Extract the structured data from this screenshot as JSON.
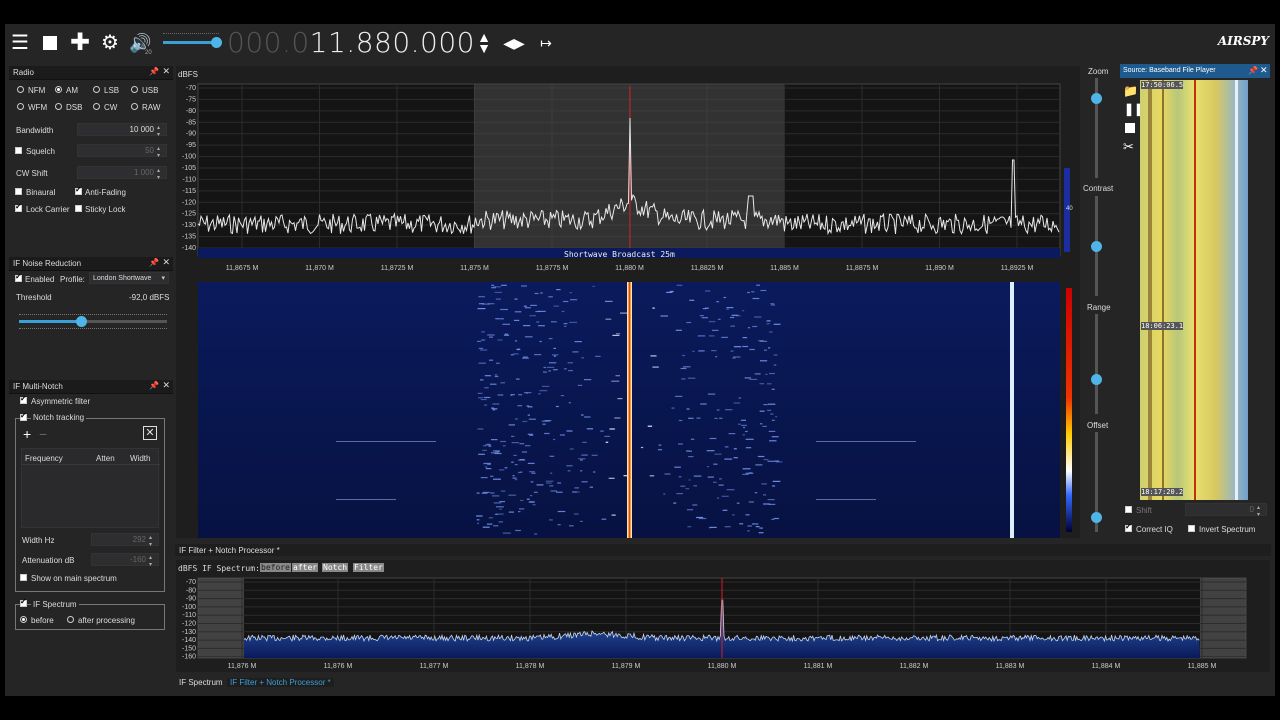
{
  "toolbar": {
    "volume_level": 0.95,
    "volume_scale": "20",
    "frequency_dim": "000.0",
    "frequency_bright": "11.880.000",
    "logo": "AIRSPY"
  },
  "radio_panel": {
    "title": "Radio",
    "modes": [
      "NFM",
      "AM",
      "LSB",
      "USB",
      "WFM",
      "DSB",
      "CW",
      "RAW"
    ],
    "selected_mode": "AM",
    "bandwidth_label": "Bandwidth",
    "bandwidth_value": "10 000",
    "squelch_label": "Squelch",
    "squelch_value": "50",
    "cw_shift_label": "CW Shift",
    "cw_shift_value": "1 000",
    "binaural_label": "Binaural",
    "anti_fading_label": "Anti-Fading",
    "lock_carrier_label": "Lock Carrier",
    "sticky_lock_label": "Sticky Lock"
  },
  "noise_panel": {
    "title": "IF Noise Reduction",
    "enabled_label": "Enabled",
    "profile_label": "Profile:",
    "profile_value": "London Shortwave",
    "threshold_label": "Threshold",
    "threshold_value": "-92,0 dBFS",
    "threshold_level": 0.42
  },
  "notch_panel": {
    "title": "IF Multi-Notch",
    "asym_label": "Asymmetric filter",
    "tracking_label": "Notch tracking",
    "add_icon": "+",
    "remove_icon": "−",
    "col_frequency": "Frequency",
    "col_atten": "Atten",
    "col_width": "Width",
    "width_label": "Width Hz",
    "width_value": "292",
    "atten_label": "Attenuation dB",
    "atten_value": "-160",
    "show_label": "Show on main spectrum",
    "ifspec_label": "IF Spectrum",
    "before_label": "before",
    "after_label": "after processing"
  },
  "main_spectrum": {
    "unit": "dBFS",
    "y_ticks": [
      "-70",
      "-75",
      "-80",
      "-85",
      "-90",
      "-95",
      "-100",
      "-105",
      "-110",
      "-115",
      "-120",
      "-125",
      "-130",
      "-135",
      "-140"
    ],
    "x_ticks": [
      "11,8675 M",
      "11,870 M",
      "11,8725 M",
      "11,875 M",
      "11,8775 M",
      "11,880 M",
      "11,8825 M",
      "11,885 M",
      "11,8875 M",
      "11,890 M",
      "11,8925 M"
    ],
    "band_label": "Shortwave Broadcast 25m",
    "right_value": "40"
  },
  "right_controls": {
    "zoom": "Zoom",
    "contrast": "Contrast",
    "range": "Range",
    "offset": "Offset",
    "zoom_level": 0.8,
    "contrast_level": 0.5,
    "range_level": 0.35,
    "offset_level": 0.15
  },
  "file_player": {
    "title": "Source: Baseband File Player",
    "time1": "17:50:06.5",
    "time2": "18:06:23.1",
    "time3": "18:17:20.2",
    "shift_label": "Shift",
    "shift_value": "0",
    "correct_iq_label": "Correct IQ",
    "invert_label": "Invert Spectrum"
  },
  "if_filter": {
    "title": "IF Filter + Notch Processor *",
    "spec_label": "dBFS IF Spectrum:",
    "btn_before": "before",
    "btn_after": "after",
    "btn_notch": "Notch",
    "btn_filter": "Filter",
    "y_ticks": [
      "-70",
      "-80",
      "-90",
      "-100",
      "-110",
      "-120",
      "-130",
      "-140",
      "-150",
      "-160"
    ],
    "x_ticks": [
      "11,876 M",
      "11,876 M",
      "11,877 M",
      "11,878 M",
      "11,879 M",
      "11,880 M",
      "11,881 M",
      "11,882 M",
      "11,883 M",
      "11,884 M",
      "11,885 M"
    ]
  },
  "bottom_tabs": {
    "tab1": "IF Spectrum",
    "tab2": "IF Filter + Notch Processor *"
  }
}
